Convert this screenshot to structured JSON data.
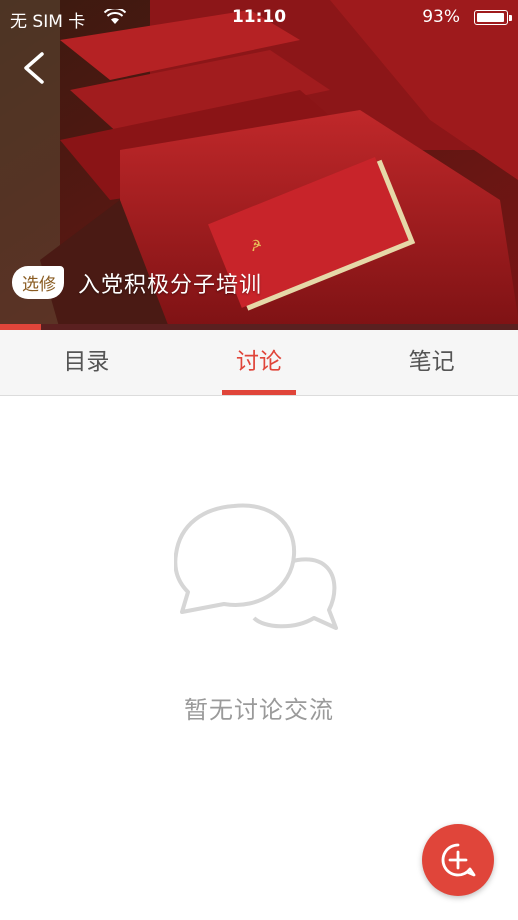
{
  "status_bar": {
    "carrier": "无 SIM 卡",
    "time": "11:10",
    "battery": "93%",
    "battery_level": 0.93
  },
  "course": {
    "badge": "选修",
    "title": "入党积极分子培训",
    "progress": 0.08
  },
  "tabs": [
    {
      "label": "目录",
      "active": false
    },
    {
      "label": "讨论",
      "active": true
    },
    {
      "label": "笔记",
      "active": false
    }
  ],
  "empty_state": {
    "message": "暂无讨论交流"
  },
  "colors": {
    "accent": "#e0453a",
    "badge_text": "#8a5c22"
  },
  "icons": {
    "back": "chevron-left-icon",
    "wifi": "wifi-icon",
    "empty": "chat-bubbles-icon",
    "fab": "add-comment-icon"
  }
}
